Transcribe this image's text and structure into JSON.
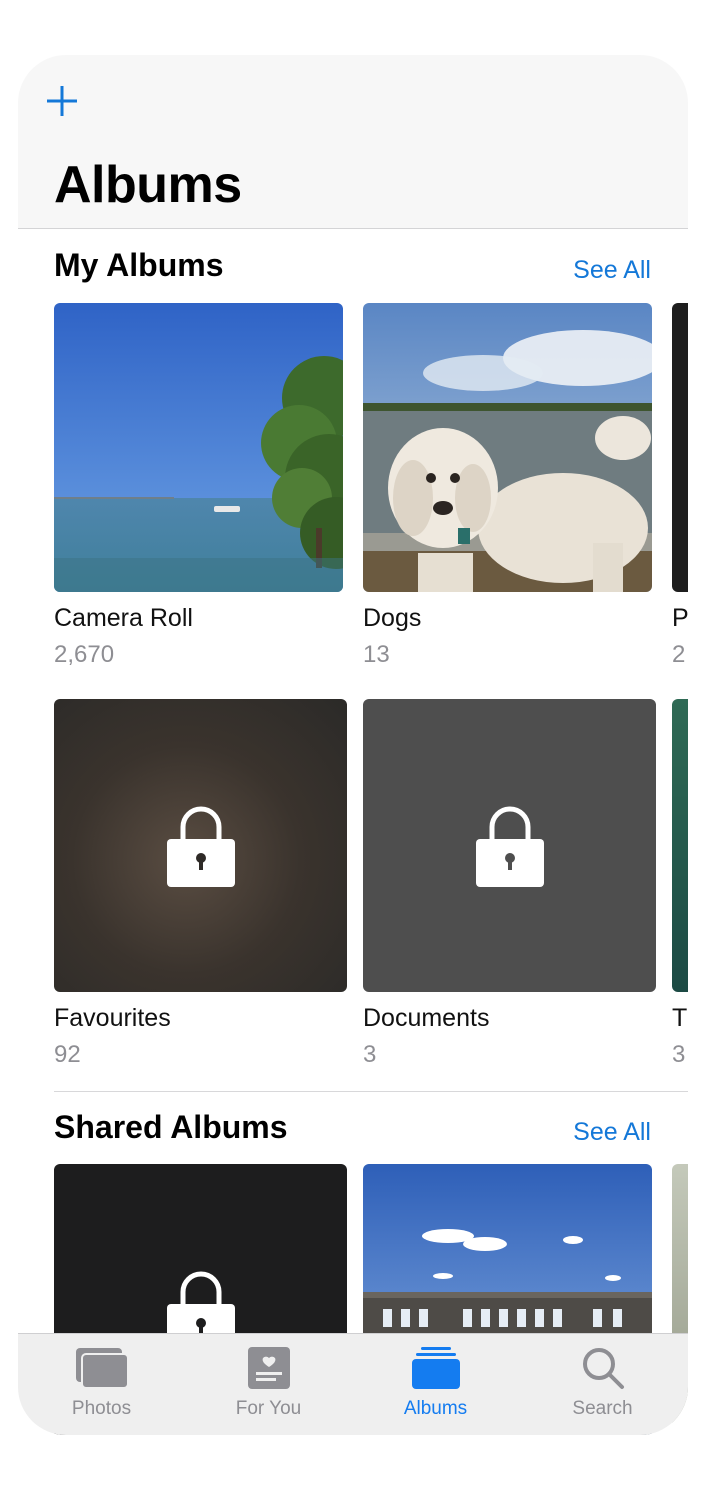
{
  "header": {
    "title": "Albums",
    "add_icon": "plus-icon"
  },
  "my_albums": {
    "title": "My Albums",
    "see_all": "See All",
    "row1": [
      {
        "name": "Camera Roll",
        "count": "2,670"
      },
      {
        "name": "Dogs",
        "count": "13"
      },
      {
        "name": "P",
        "count": "2"
      }
    ],
    "row2": [
      {
        "name": "Favourites",
        "count": "92",
        "icon": "lock-icon"
      },
      {
        "name": "Documents",
        "count": "3",
        "icon": "lock-icon"
      },
      {
        "name": "T",
        "count": "3"
      }
    ]
  },
  "shared_albums": {
    "title": "Shared Albums",
    "see_all": "See All"
  },
  "tabbar": {
    "tabs": [
      {
        "label": "Photos",
        "icon": "photos-icon"
      },
      {
        "label": "For You",
        "icon": "for-you-icon"
      },
      {
        "label": "Albums",
        "icon": "albums-icon",
        "active": true
      },
      {
        "label": "Search",
        "icon": "search-icon"
      }
    ]
  },
  "colors": {
    "accent": "#1478d8",
    "active_tab": "#147cf0",
    "secondary_text": "#8e8e93"
  }
}
